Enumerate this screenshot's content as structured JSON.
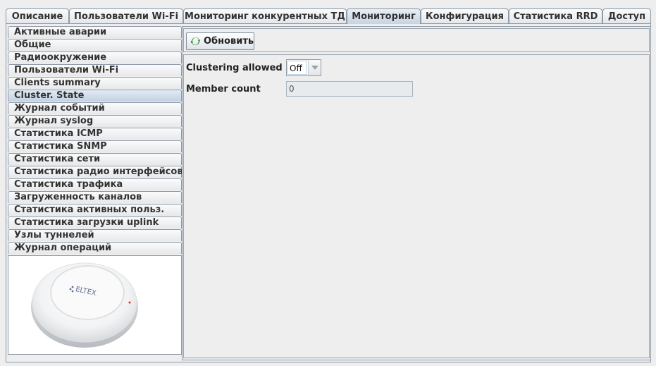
{
  "top_tabs": [
    {
      "label": "Описание"
    },
    {
      "label": "Пользователи Wi-Fi"
    },
    {
      "label": "Мониторинг конкурентных ТД"
    },
    {
      "label": "Мониторинг"
    },
    {
      "label": "Конфигурация"
    },
    {
      "label": "Статистика RRD"
    },
    {
      "label": "Доступ"
    }
  ],
  "active_top_tab": "Мониторинг",
  "side_menu": {
    "items": [
      {
        "label": "Активные аварии"
      },
      {
        "label": "Общие"
      },
      {
        "label": "Радиоокружение"
      },
      {
        "label": "Пользователи Wi-Fi"
      },
      {
        "label": "Clients summary"
      },
      {
        "label": "Cluster. State"
      },
      {
        "label": "Журнал событий"
      },
      {
        "label": "Журнал syslog"
      },
      {
        "label": "Статистика ICMP"
      },
      {
        "label": "Статистика SNMP"
      },
      {
        "label": "Статистика сети"
      },
      {
        "label": "Статистика радио интерфейсов"
      },
      {
        "label": "Статистика трафика"
      },
      {
        "label": "Загруженность каналов"
      },
      {
        "label": "Статистика активных польз."
      },
      {
        "label": "Статистика загрузки uplink"
      },
      {
        "label": "Узлы туннелей"
      },
      {
        "label": "Журнал операций"
      }
    ],
    "active_item": "Cluster. State",
    "device_logo_text": "ELTEX"
  },
  "toolbar": {
    "refresh_label": "Обновить",
    "refresh_icon": "refresh-icon"
  },
  "form": {
    "clustering_label": "Clustering allowed",
    "clustering_value": "Off",
    "member_count_label": "Member count",
    "member_count_value": "0"
  },
  "colors": {
    "active_tab": "#c6d3e2",
    "border": "#8d9aa8",
    "refresh_icon_green": "#3da33a"
  }
}
